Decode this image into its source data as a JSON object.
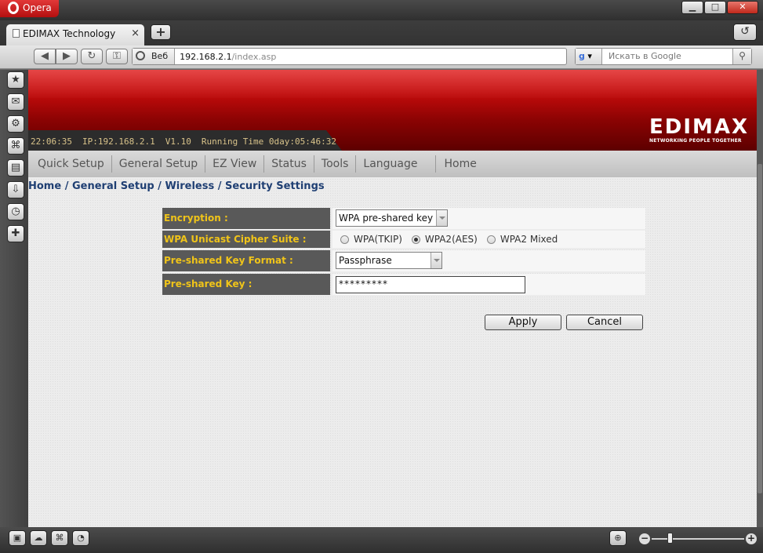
{
  "browser": {
    "app_name": "Opera",
    "tab_title": "EDIMAX Technology",
    "tab_close": "×",
    "new_tab": "+",
    "address_chip": "Веб",
    "url_host": "192.168.2.1",
    "url_path": "/index.asp",
    "search_engine": "g",
    "search_placeholder": "Искать в Google",
    "window_buttons": {
      "minimize": "▁",
      "maximize": "□",
      "close": "✕"
    }
  },
  "router": {
    "status": {
      "time": "22:06:35",
      "ip": "IP:192.168.2.1",
      "version": "V1.10",
      "running_time": "Running Time 0day:05:46:32"
    },
    "logo": "EDIMAX",
    "tagline": "NETWORKING PEOPLE TOGETHER",
    "menu": [
      {
        "label": "Quick Setup"
      },
      {
        "label": "General Setup"
      },
      {
        "label": "EZ View"
      },
      {
        "label": "Status"
      },
      {
        "label": "Tools"
      },
      {
        "label": "Language"
      },
      {
        "label": "Home"
      }
    ],
    "breadcrumb": "Home / General Setup / Wireless / Security Settings",
    "form": {
      "encryption_label": "Encryption :",
      "encryption_value": "WPA pre-shared key",
      "cipher_label": "WPA Unicast Cipher Suite :",
      "cipher_options": [
        "WPA(TKIP)",
        "WPA2(AES)",
        "WPA2 Mixed"
      ],
      "cipher_selected": "WPA2(AES)",
      "key_format_label": "Pre-shared Key Format :",
      "key_format_value": "Passphrase",
      "key_label": "Pre-shared Key :",
      "key_value": "*********"
    },
    "buttons": {
      "apply": "Apply",
      "cancel": "Cancel"
    }
  },
  "colors": {
    "banner_red": "#c10b0b",
    "label_bg": "#595959",
    "label_text": "#f0c419",
    "breadcrumb": "#1f3f73"
  }
}
